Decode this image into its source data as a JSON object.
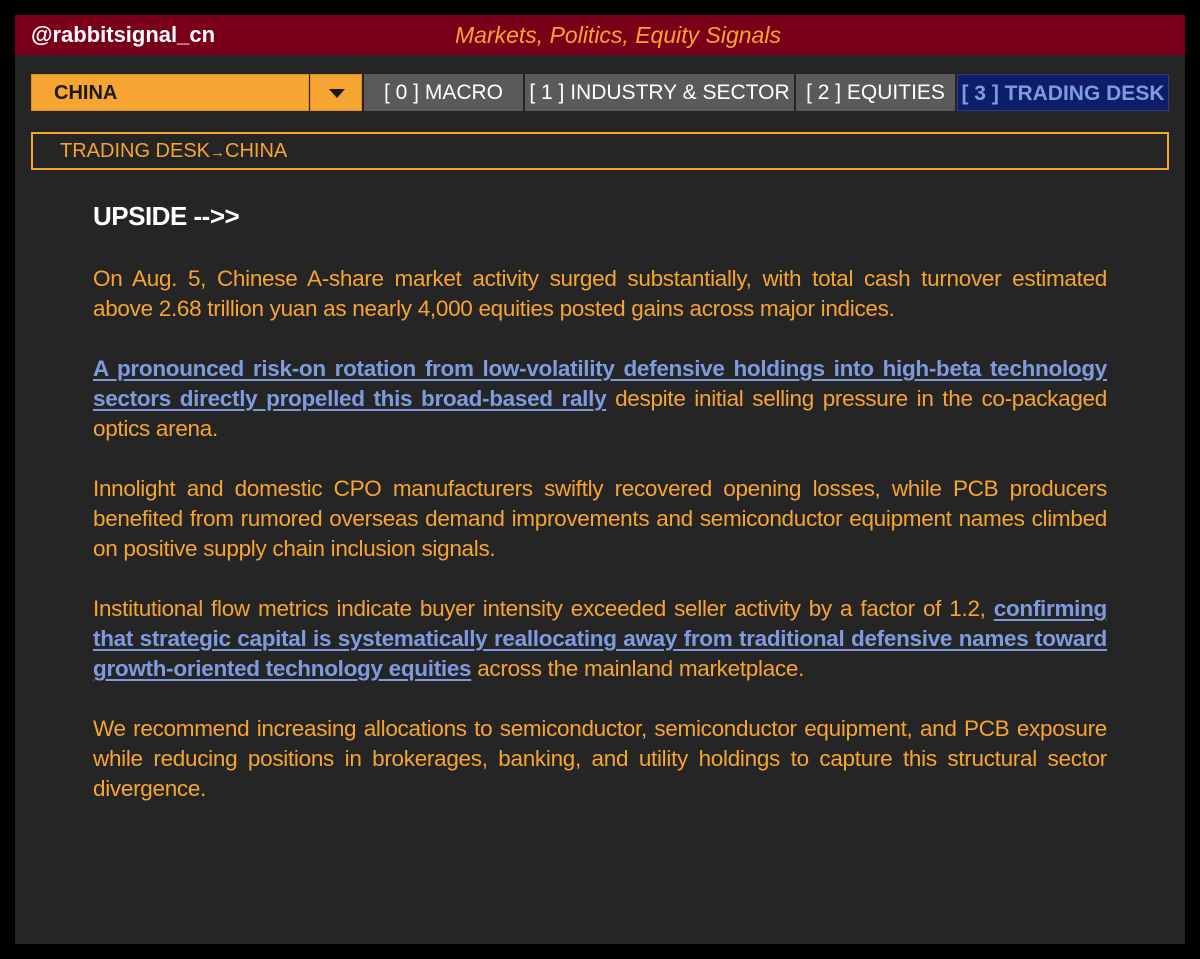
{
  "header": {
    "handle": "@rabbitsignal_cn",
    "tagline": "Markets, Politics, Equity Signals"
  },
  "region_select": {
    "selected": "CHINA",
    "toggle_icon": "caret-down-icon"
  },
  "tabs": [
    {
      "label": "[ 0 ] MACRO",
      "active": false
    },
    {
      "label": "[ 1 ] INDUSTRY & SECTOR",
      "active": false
    },
    {
      "label": "[ 2 ] EQUITIES",
      "active": false
    },
    {
      "label": "[ 3 ] TRADING DESK",
      "active": true
    }
  ],
  "breadcrumb": {
    "section": "TRADING DESK",
    "separator": "→",
    "region": "CHINA"
  },
  "article": {
    "title": "UPSIDE -->>",
    "p1": "On Aug. 5, Chinese A-share market activity surged substantially, with total cash turnover estimated above 2.68 trillion yuan as nearly 4,000 equities posted gains across major indices.",
    "p2_link": "A pronounced risk-on rotation from low-volatility defensive holdings into high-beta technology sectors directly propelled this broad-based rally",
    "p2_rest": " despite initial selling pressure in the co-packaged optics arena.",
    "p3": "Innolight and domestic CPO manufacturers swiftly recovered opening losses, while PCB producers benefited from rumored overseas demand improvements and semiconductor equipment names climbed on positive supply chain inclusion signals.",
    "p4_lead": "Institutional flow metrics indicate buyer intensity exceeded seller activity by a factor of 1.2, ",
    "p4_link": "confirming that strategic capital is systematically reallocating away from traditional defensive names toward growth-oriented technology equities",
    "p4_rest": " across the mainland marketplace.",
    "p5": "We recommend increasing allocations to semiconductor, semiconductor equipment, and PCB exposure while reducing positions in brokerages, banking, and utility holdings to capture this structural sector divergence."
  },
  "colors": {
    "header_bg": "#7a0019",
    "accent_orange": "#f6a432",
    "link_blue": "#7f9be0",
    "active_tab_bg": "#0e1d6a",
    "tab_bg": "#5a5a5a",
    "panel_bg": "#252525"
  }
}
